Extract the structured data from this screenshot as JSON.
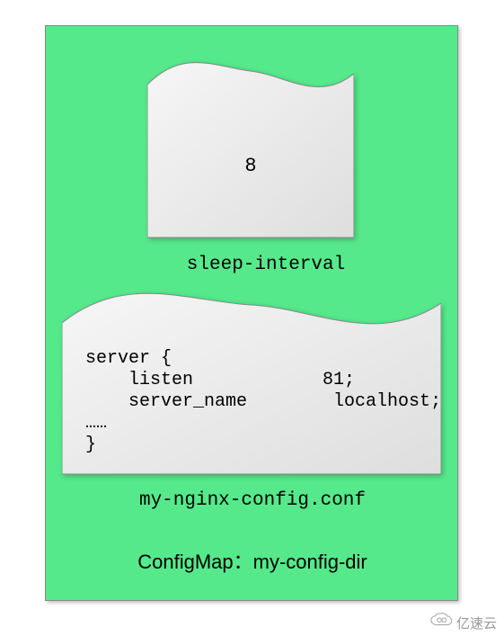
{
  "container": {
    "title_prefix": "ConfigMap：",
    "title_name": "my-config-dir"
  },
  "doc1": {
    "value": "8",
    "label": "sleep-interval"
  },
  "doc2": {
    "content": "server {\n    listen            81;\n    server_name        localhost;\n……\n}",
    "label": "my-nginx-config.conf"
  },
  "watermark": {
    "text": "亿速云"
  },
  "colors": {
    "container_bg": "#56e98b"
  }
}
